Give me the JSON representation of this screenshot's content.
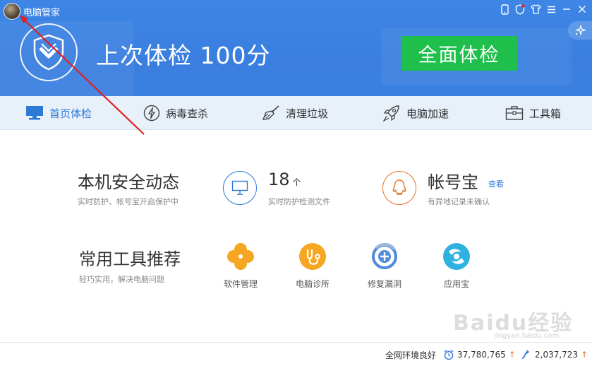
{
  "app": {
    "title": "电脑管家"
  },
  "header": {
    "last_check": "上次体检 100分",
    "full_check_button": "全面体检"
  },
  "nav": {
    "items": [
      {
        "label": "首页体检",
        "icon": "monitor-icon",
        "active": true
      },
      {
        "label": "病毒查杀",
        "icon": "lightning-icon",
        "active": false
      },
      {
        "label": "清理垃圾",
        "icon": "broom-icon",
        "active": false
      },
      {
        "label": "电脑加速",
        "icon": "rocket-icon",
        "active": false
      },
      {
        "label": "工具箱",
        "icon": "toolbox-icon",
        "active": false
      }
    ]
  },
  "security": {
    "title": "本机安全动态",
    "subtitle": "实时防护、帐号宝开启保护中",
    "files_count": "18",
    "files_unit": "个",
    "files_desc": "实时防护检测文件",
    "account_title": "帐号宝",
    "account_link": "查看",
    "account_desc": "有异地记录未确认"
  },
  "tools": {
    "title": "常用工具推荐",
    "subtitle": "轻巧实用，解决电脑问题",
    "items": [
      {
        "label": "软件管理",
        "icon": "software-manager-icon"
      },
      {
        "label": "电脑诊所",
        "icon": "stethoscope-icon"
      },
      {
        "label": "修复漏洞",
        "icon": "patch-icon"
      },
      {
        "label": "应用宝",
        "icon": "app-store-icon"
      }
    ]
  },
  "footer": {
    "status": "全网环境良好",
    "count1": "37,780,765",
    "count2": "2,037,723"
  },
  "watermark": {
    "text": "Baidu经验",
    "sub": "jingyan.baidu.com"
  },
  "colors": {
    "accent": "#2e78d8",
    "header": "#3a80e1",
    "green": "#1fbf4b",
    "orange": "#f5a623",
    "annotation": "#e02020"
  }
}
